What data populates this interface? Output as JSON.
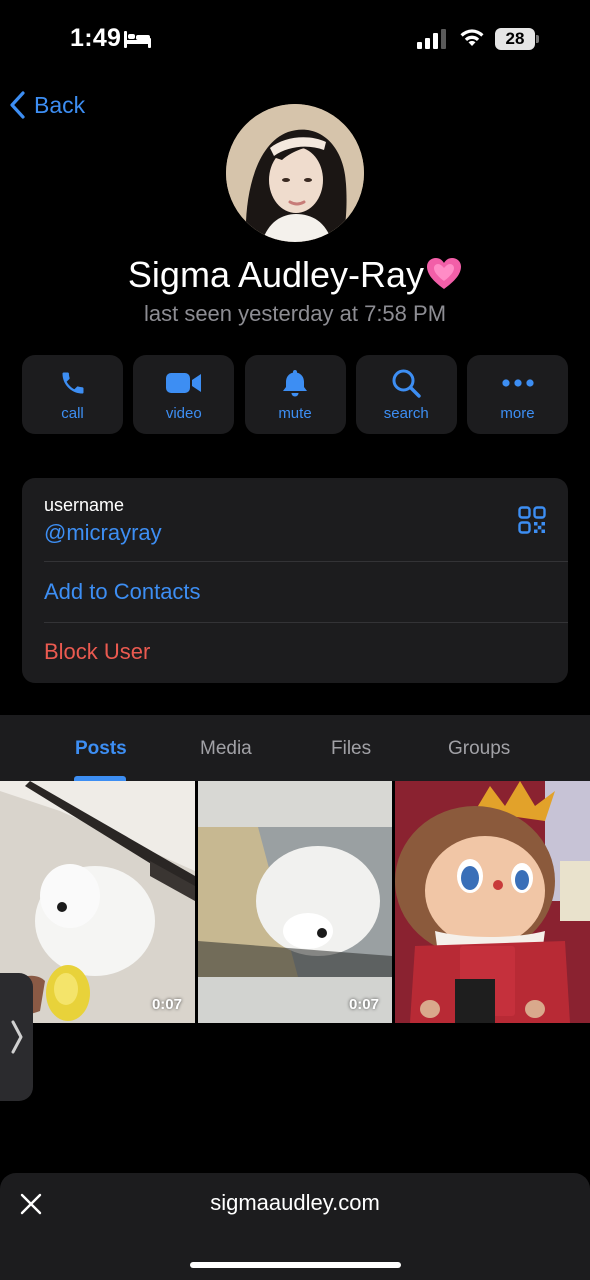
{
  "status_bar": {
    "time": "1:49",
    "battery": "28",
    "icons": [
      "bed-icon",
      "cellular-signal-icon",
      "wifi-icon",
      "battery-icon"
    ]
  },
  "nav": {
    "back_label": "Back"
  },
  "profile": {
    "name": "Sigma Audley-Ray",
    "name_emoji_icon": "pink-heart-icon",
    "last_seen": "last seen yesterday at 7:58 PM"
  },
  "actions": [
    {
      "label": "call",
      "icon": "phone-icon"
    },
    {
      "label": "video",
      "icon": "video-camera-icon"
    },
    {
      "label": "mute",
      "icon": "bell-icon"
    },
    {
      "label": "search",
      "icon": "search-icon"
    },
    {
      "label": "more",
      "icon": "more-dots-icon"
    }
  ],
  "info": {
    "username_label": "username",
    "username": "@micrayray",
    "add_contacts": "Add to Contacts",
    "block_user": "Block User"
  },
  "tabs": [
    {
      "label": "Posts",
      "active": true
    },
    {
      "label": "Media",
      "active": false
    },
    {
      "label": "Files",
      "active": false
    },
    {
      "label": "Groups",
      "active": false
    }
  ],
  "media": [
    {
      "duration": "0:07",
      "subject": "white dog drinking"
    },
    {
      "duration": "0:07",
      "subject": "white dog sleeping"
    },
    {
      "duration": "",
      "subject": "plush doll figure"
    }
  ],
  "bottom_bar": {
    "url": "sigmaaudley.com"
  },
  "colors": {
    "accent": "#3d8ef3",
    "destructive": "#ea5a50",
    "card": "#1c1c1e",
    "background": "#000000",
    "secondary_text": "#8d8d93"
  }
}
